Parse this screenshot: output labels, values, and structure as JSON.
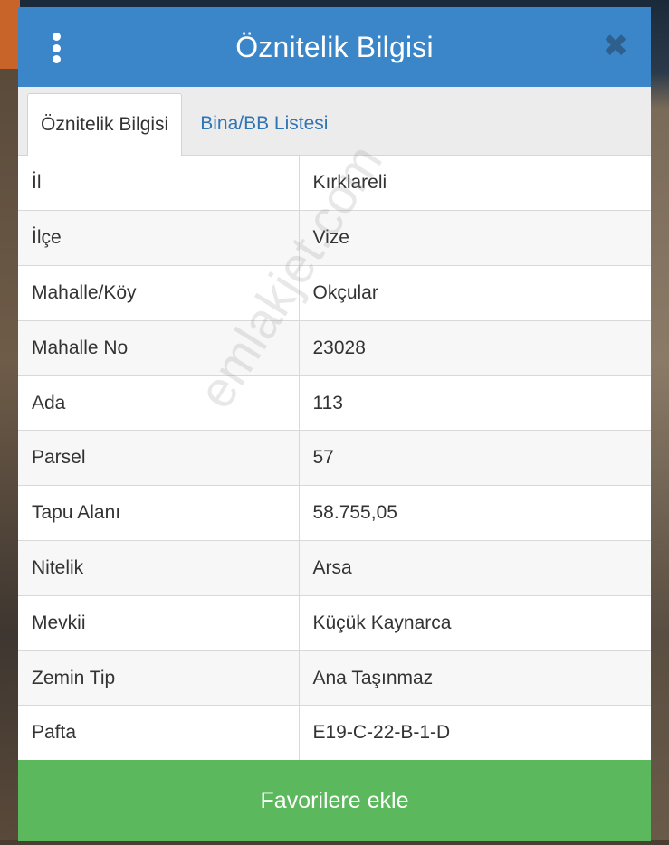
{
  "header": {
    "title": "Öznitelik Bilgisi",
    "menu_icon": "vertical-dots-icon",
    "close_icon": "close-icon"
  },
  "tabs": [
    {
      "label": "Öznitelik Bilgisi",
      "active": true
    },
    {
      "label": "Bina/BB Listesi",
      "active": false
    }
  ],
  "attributes": [
    {
      "key": "İl",
      "value": "Kırklareli"
    },
    {
      "key": "İlçe",
      "value": "Vize"
    },
    {
      "key": "Mahalle/Köy",
      "value": "Okçular"
    },
    {
      "key": "Mahalle No",
      "value": "23028"
    },
    {
      "key": "Ada",
      "value": "113"
    },
    {
      "key": "Parsel",
      "value": "57"
    },
    {
      "key": "Tapu Alanı",
      "value": "58.755,05"
    },
    {
      "key": "Nitelik",
      "value": "Arsa"
    },
    {
      "key": "Mevkii",
      "value": "Küçük Kaynarca"
    },
    {
      "key": "Zemin Tip",
      "value": "Ana Taşınmaz"
    },
    {
      "key": "Pafta",
      "value": "E19-C-22-B-1-D"
    }
  ],
  "watermark": "emlakjet.com",
  "footer": {
    "favorite_label": "Favorilere ekle"
  },
  "colors": {
    "header": "#3a86c8",
    "tab_link": "#2f74b5",
    "favorite_button": "#5cb85c"
  }
}
